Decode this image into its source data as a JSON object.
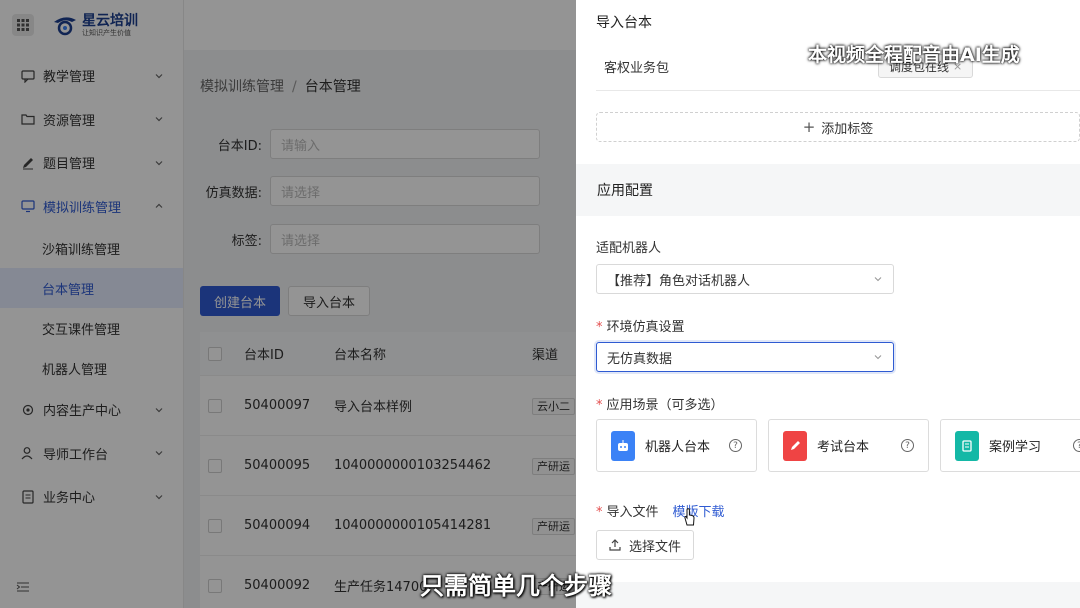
{
  "brand": {
    "title": "星云培训",
    "subtitle": "让知识产生价值"
  },
  "sidebar": {
    "items": [
      {
        "label": "教学管理",
        "icon": "chat-icon"
      },
      {
        "label": "资源管理",
        "icon": "folder-icon"
      },
      {
        "label": "题目管理",
        "icon": "edit-icon"
      },
      {
        "label": "模拟训练管理",
        "icon": "monitor-icon"
      }
    ],
    "sub_items": [
      "沙箱训练管理",
      "台本管理",
      "交互课件管理",
      "机器人管理"
    ],
    "items_after": [
      {
        "label": "内容生产中心",
        "icon": "settings-icon"
      },
      {
        "label": "导师工作台",
        "icon": "user-icon"
      },
      {
        "label": "业务中心",
        "icon": "doc-icon"
      }
    ]
  },
  "breadcrumb": {
    "parent": "模拟训练管理",
    "sep": "/",
    "current": "台本管理"
  },
  "filters": {
    "id_label": "台本ID:",
    "id_placeholder": "请输入",
    "sim_label": "仿真数据:",
    "sim_placeholder": "请选择",
    "tag_label": "标签:",
    "tag_placeholder": "请选择"
  },
  "actions": {
    "create": "创建台本",
    "import": "导入台本"
  },
  "table": {
    "headers": [
      "台本ID",
      "台本名称",
      "渠道"
    ],
    "rows": [
      {
        "id": "50400097",
        "name": "导入台本样例",
        "channel": "云小二"
      },
      {
        "id": "50400095",
        "name": "1040000000103254462",
        "channel": "产研运"
      },
      {
        "id": "50400094",
        "name": "1040000000105414281",
        "channel": "产研运"
      },
      {
        "id": "50400092",
        "name": "生产任务14700",
        "channel": "产研运"
      }
    ]
  },
  "drawer": {
    "title": "导入台本",
    "business_label": "客权业务包",
    "chip_label": "调度包在线",
    "chip_close": "×",
    "add_tag": "添加标签",
    "section_title": "应用配置",
    "robot_label": "适配机器人",
    "robot_value": "【推荐】角色对话机器人",
    "env_label": "环境仿真设置",
    "env_value": "无仿真数据",
    "scene_label": "应用场景（可多选）",
    "scenes": [
      {
        "label": "机器人台本",
        "color": "#3b82f6",
        "icon": "robot-icon"
      },
      {
        "label": "考试台本",
        "color": "#ef4444",
        "icon": "pen-icon"
      },
      {
        "label": "案例学习",
        "color": "#14b8a6",
        "icon": "book-icon"
      }
    ],
    "file_label": "导入文件",
    "template_link": "模版下载",
    "upload_label": "选择文件",
    "required_mark": "*",
    "help_mark": "?"
  },
  "captions": {
    "top": "本视频全程配音由AI生成",
    "bottom": "只需简单几个步骤"
  }
}
